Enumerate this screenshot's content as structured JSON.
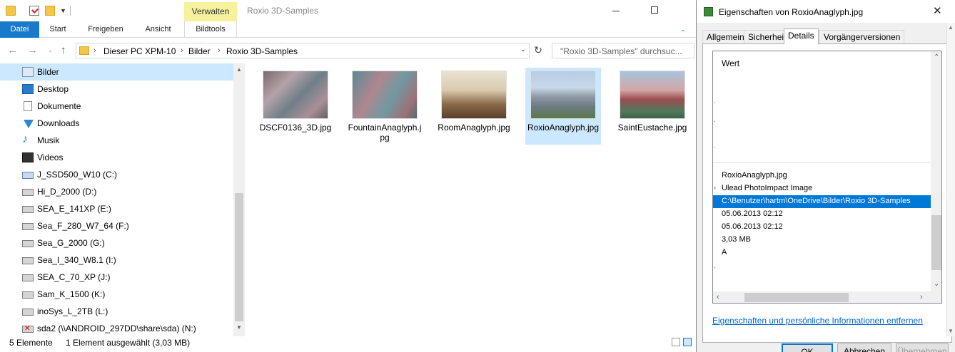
{
  "explorer": {
    "contextual_tab": "Verwalten",
    "title": "Roxio 3D-Samples",
    "ribbon_tabs": {
      "datei": "Datei",
      "start": "Start",
      "freigeben": "Freigeben",
      "ansicht": "Ansicht",
      "bildtools": "Bildtools"
    },
    "breadcrumb": [
      "Dieser PC XPM-10",
      "Bilder",
      "Roxio 3D-Samples"
    ],
    "search_placeholder": "\"Roxio 3D-Samples\" durchsuc...",
    "sidebar": [
      {
        "label": "Bilder",
        "icon": "pictures-icon",
        "selected": true
      },
      {
        "label": "Desktop",
        "icon": "desktop-icon"
      },
      {
        "label": "Dokumente",
        "icon": "documents-icon"
      },
      {
        "label": "Downloads",
        "icon": "downloads-icon"
      },
      {
        "label": "Musik",
        "icon": "music-icon"
      },
      {
        "label": "Videos",
        "icon": "videos-icon"
      },
      {
        "label": "J_SSD500_W10 (C:)",
        "icon": "system-drive-icon"
      },
      {
        "label": "Hi_D_2000 (D:)",
        "icon": "drive-icon"
      },
      {
        "label": "SEA_E_141XP (E:)",
        "icon": "drive-icon"
      },
      {
        "label": "Sea_F_280_W7_64 (F:)",
        "icon": "drive-icon"
      },
      {
        "label": "Sea_G_2000 (G:)",
        "icon": "drive-icon"
      },
      {
        "label": "Sea_I_340_W8.1 (I:)",
        "icon": "drive-icon"
      },
      {
        "label": "SEA_C_70_XP (J:)",
        "icon": "drive-icon"
      },
      {
        "label": "Sam_K_1500 (K:)",
        "icon": "drive-icon"
      },
      {
        "label": "inoSys_L_2TB (L:)",
        "icon": "drive-icon"
      },
      {
        "label": "sda2 (\\\\ANDROID_297DD\\share\\sda) (N:)",
        "icon": "network-drive-disconnected-icon"
      }
    ],
    "files": [
      {
        "name": "DSCF0136_3D.jpg",
        "selected": false
      },
      {
        "name": "FountainAnaglyph.jpg",
        "selected": false
      },
      {
        "name": "RoomAnaglyph.jpg",
        "selected": false
      },
      {
        "name": "RoxioAnaglyph.jpg",
        "selected": true
      },
      {
        "name": "SaintEustache.jpg",
        "selected": false
      }
    ],
    "status": {
      "count": "5 Elemente",
      "selected": "1 Element ausgewählt (3,03 MB)"
    }
  },
  "dialog": {
    "title": "Eigenschaften von RoxioAnaglyph.jpg",
    "tabs": {
      "allgemein": "Allgemein",
      "sicherheit": "Sicherheit",
      "details": "Details",
      "vorgaenger": "Vorgängerversionen"
    },
    "column_header": "Wert",
    "values": [
      "RoxioAnaglyph.jpg",
      "Ulead PhotoImpact Image",
      "C:\\Benutzer\\hartm\\OneDrive\\Bilder\\Roxio 3D-Samples",
      "05.06.2013 02:12",
      "05.06.2013 02:12",
      "3,03 MB",
      "A"
    ],
    "highlighted_index": 2,
    "remove_link": "Eigenschaften und persönliche Informationen entfernen",
    "buttons": {
      "ok": "OK",
      "cancel": "Abbrechen",
      "apply": "Übernehmen"
    },
    "colors": {
      "accent": "#0078d7",
      "selection": "#cce8ff",
      "contextual_tab": "#f6f19c"
    }
  }
}
